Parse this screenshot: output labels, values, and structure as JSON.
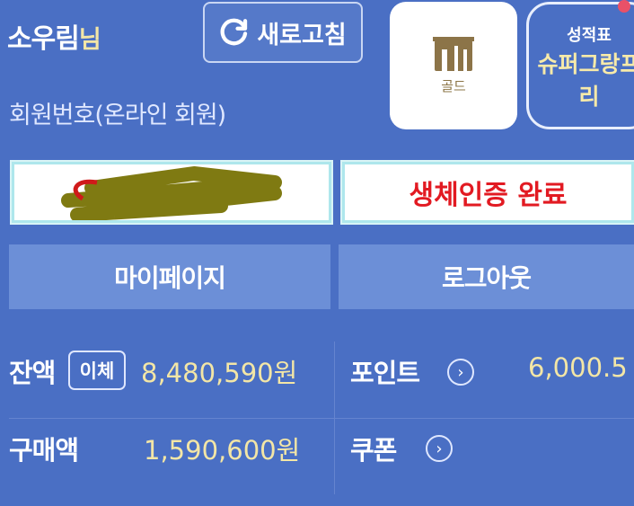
{
  "user": {
    "name": "소우림",
    "suffix": "님",
    "member_no": "회원번호(온라인 회원)"
  },
  "header": {
    "refresh_label": "새로고침",
    "grade_label": "골드",
    "report_title": "성적표",
    "report_sub_line1": "슈퍼그랑프",
    "report_sub_line2": "리"
  },
  "auth": {
    "biometric_status": "생체인증 완료"
  },
  "nav": {
    "mypage_label": "마이페이지",
    "logout_label": "로그아웃"
  },
  "account": {
    "balance_label": "잔액",
    "transfer_label": "이체",
    "balance_value": "8,480,590원",
    "points_label": "포인트",
    "points_value": "6,000.5",
    "purchase_label": "구매액",
    "purchase_value": "1,590,600원",
    "coupon_label": "쿠폰"
  },
  "colors": {
    "background": "#4a6fc4",
    "accent_yellow": "#f3e6a6",
    "bio_red": "#e21a22",
    "nav_button": "#6c8fd7",
    "notify_dot": "#e95168",
    "scribble": "#7f7a12"
  }
}
